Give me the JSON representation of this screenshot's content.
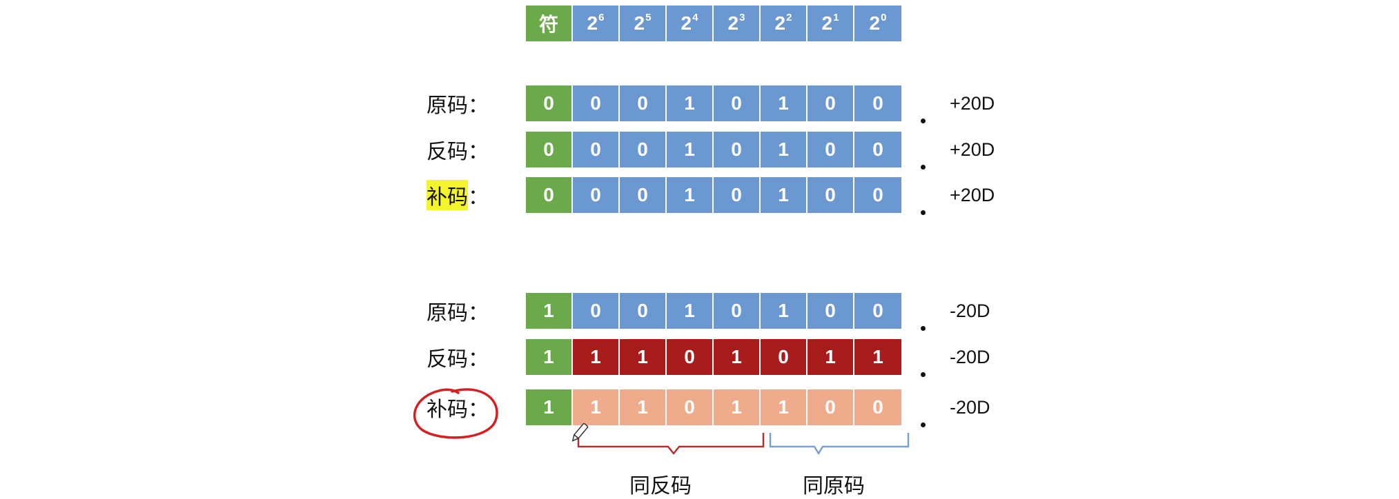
{
  "header": [
    "符",
    "2",
    "2",
    "2",
    "2",
    "2",
    "2",
    "2"
  ],
  "header_exponents": [
    "",
    "6",
    "5",
    "4",
    "3",
    "2",
    "1",
    "0"
  ],
  "positive": {
    "rows": [
      {
        "label": "原码",
        "colon": "：",
        "sign": "0",
        "bits": [
          "0",
          "0",
          "1",
          "0",
          "1",
          "0",
          "0"
        ],
        "value": "+20D"
      },
      {
        "label": "反码",
        "colon": "：",
        "sign": "0",
        "bits": [
          "0",
          "0",
          "1",
          "0",
          "1",
          "0",
          "0"
        ],
        "value": "+20D"
      },
      {
        "label": "补码",
        "colon": "：",
        "sign": "0",
        "bits": [
          "0",
          "0",
          "1",
          "0",
          "1",
          "0",
          "0"
        ],
        "value": "+20D"
      }
    ]
  },
  "negative": {
    "rows": [
      {
        "label": "原码",
        "colon": "：",
        "sign": "1",
        "bits": [
          "0",
          "0",
          "1",
          "0",
          "1",
          "0",
          "0"
        ],
        "value": "-20D"
      },
      {
        "label": "反码",
        "colon": "：",
        "sign": "1",
        "bits": [
          "1",
          "1",
          "0",
          "1",
          "0",
          "1",
          "1"
        ],
        "value": "-20D"
      },
      {
        "label": "补码",
        "colon": "：",
        "sign": "1",
        "bits": [
          "1",
          "1",
          "0",
          "1",
          "1",
          "0",
          "0"
        ],
        "value": "-20D"
      }
    ]
  },
  "captions": {
    "left": "同反码",
    "right": "同原码"
  },
  "colors": {
    "sign": "#6aaa4a",
    "blue": "#6b98d0",
    "red": "#a81c1c",
    "peach": "#eeac8d",
    "highlight": "#f4f42c",
    "circle": "#d42020",
    "bracket_red": "#b03030",
    "bracket_blue": "#7a9fd0"
  }
}
